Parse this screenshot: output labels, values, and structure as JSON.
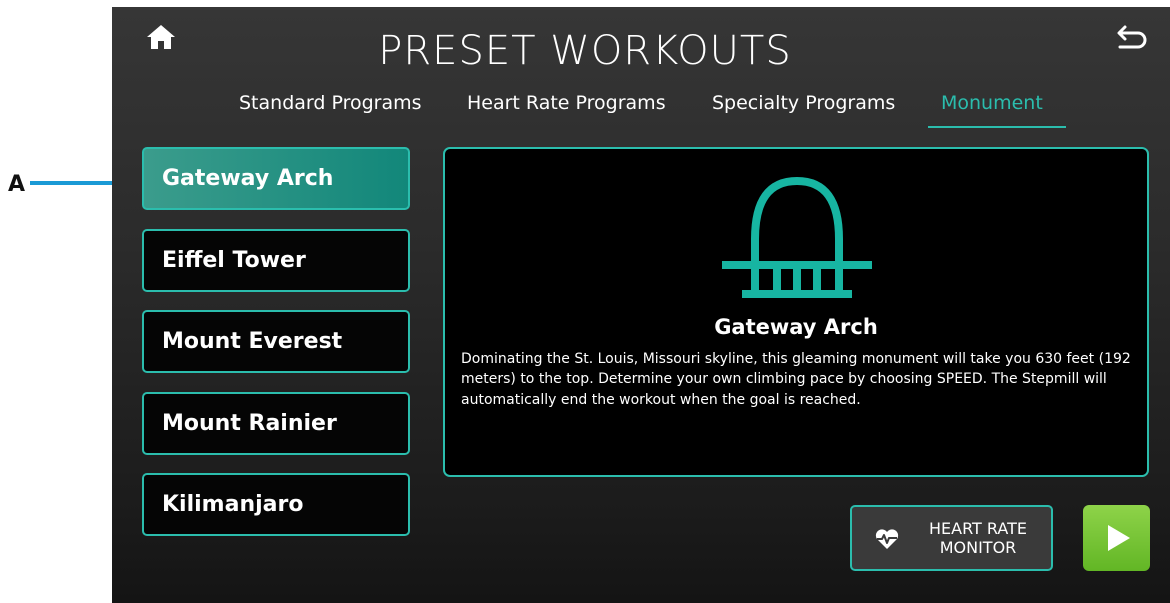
{
  "callout": {
    "letter": "A"
  },
  "header": {
    "title": "PRESET WORKOUTS",
    "home_icon": "home-icon",
    "back_icon": "back-arrow-icon"
  },
  "tabs": [
    {
      "label": "Standard Programs",
      "active": false
    },
    {
      "label": "Heart Rate Programs",
      "active": false
    },
    {
      "label": "Specialty Programs",
      "active": false
    },
    {
      "label": "Monument",
      "active": true
    }
  ],
  "programs": [
    {
      "label": "Gateway Arch",
      "selected": true
    },
    {
      "label": "Eiffel Tower",
      "selected": false
    },
    {
      "label": "Mount Everest",
      "selected": false
    },
    {
      "label": "Mount Rainier",
      "selected": false
    },
    {
      "label": "Kilimanjaro",
      "selected": false
    }
  ],
  "detail": {
    "icon": "gateway-arch-icon",
    "title": "Gateway Arch",
    "description": "Dominating the St. Louis, Missouri skyline, this gleaming monument will take you 630 feet (192 meters) to the top. Determine your own climbing pace by choosing SPEED. The Stepmill will automatically end the workout when the goal is reached."
  },
  "actions": {
    "heart_rate_label": "HEART RATE\nMONITOR",
    "heart_rate_icon": "heart-pulse-icon",
    "start_icon": "play-icon"
  },
  "colors": {
    "accent": "#2bbdad",
    "callout_line": "#1a9ad6",
    "play_green": "#74c535",
    "selected_fill": "#1a8c7e"
  }
}
